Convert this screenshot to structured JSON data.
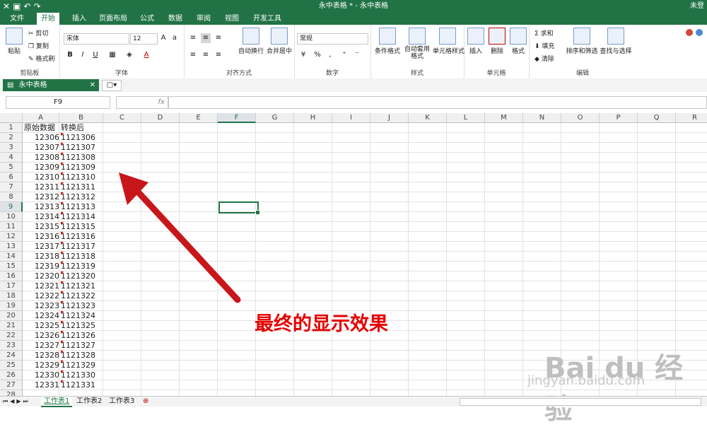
{
  "titlebar": {
    "title": "永中表格 * - 永中表格",
    "user": "未登",
    "undo_icon": "↶",
    "redo_icon": "↷"
  },
  "menu": [
    {
      "label": "文件"
    },
    {
      "label": "开始"
    },
    {
      "label": "插入"
    },
    {
      "label": "页面布局"
    },
    {
      "label": "公式"
    },
    {
      "label": "数据"
    },
    {
      "label": "审阅"
    },
    {
      "label": "视图"
    },
    {
      "label": "开发工具"
    }
  ],
  "ribbon": {
    "clipboard": {
      "paste": "粘贴",
      "cut": "剪切",
      "copy": "复制",
      "format_painter": "格式刷",
      "group": "剪贴板"
    },
    "font": {
      "name": "宋体",
      "size": "12",
      "bold": "B",
      "italic": "I",
      "underline": "U",
      "group": "字体",
      "font_color": "A"
    },
    "align": {
      "wrap": "自动换行",
      "merge": "合并居中",
      "group": "对齐方式"
    },
    "number": {
      "format": "常规",
      "percent": "%",
      "comma": ",",
      "group": "数字"
    },
    "styles": {
      "cond": "条件格式",
      "table": "自动套用格式",
      "cell": "单元格样式",
      "group": "样式"
    },
    "cells": {
      "insert": "插入",
      "delete": "删除",
      "format": "格式",
      "group": "单元格"
    },
    "edit": {
      "sum": "求和",
      "fill": "填充",
      "clear": "清除",
      "sort": "排序和筛选",
      "find": "查找与选择",
      "group": "编辑"
    }
  },
  "doc_tab": "永中表格",
  "formula": {
    "namebox": "F9",
    "fx": "fx",
    "content": ""
  },
  "columns": [
    "A",
    "B",
    "C",
    "D",
    "E",
    "F",
    "G",
    "H",
    "I",
    "J",
    "K",
    "L",
    "M",
    "N",
    "O",
    "P",
    "Q",
    "R"
  ],
  "rows": [
    {
      "n": "1",
      "a": "原始数据",
      "b": "转换后"
    },
    {
      "n": "2",
      "a": "12306",
      "b": "1121306"
    },
    {
      "n": "3",
      "a": "12307",
      "b": "1121307"
    },
    {
      "n": "4",
      "a": "12308",
      "b": "1121308"
    },
    {
      "n": "5",
      "a": "12309",
      "b": "1121309"
    },
    {
      "n": "6",
      "a": "12310",
      "b": "1121310"
    },
    {
      "n": "7",
      "a": "12311",
      "b": "1121311"
    },
    {
      "n": "8",
      "a": "12312",
      "b": "1121312"
    },
    {
      "n": "9",
      "a": "12313",
      "b": "1121313"
    },
    {
      "n": "10",
      "a": "12314",
      "b": "1121314"
    },
    {
      "n": "11",
      "a": "12315",
      "b": "1121315"
    },
    {
      "n": "12",
      "a": "12316",
      "b": "1121316"
    },
    {
      "n": "13",
      "a": "12317",
      "b": "1121317"
    },
    {
      "n": "14",
      "a": "12318",
      "b": "1121318"
    },
    {
      "n": "15",
      "a": "12319",
      "b": "1121319"
    },
    {
      "n": "16",
      "a": "12320",
      "b": "1121320"
    },
    {
      "n": "17",
      "a": "12321",
      "b": "1121321"
    },
    {
      "n": "18",
      "a": "12322",
      "b": "1121322"
    },
    {
      "n": "19",
      "a": "12323",
      "b": "1121323"
    },
    {
      "n": "20",
      "a": "12324",
      "b": "1121324"
    },
    {
      "n": "21",
      "a": "12325",
      "b": "1121325"
    },
    {
      "n": "22",
      "a": "12326",
      "b": "1121326"
    },
    {
      "n": "23",
      "a": "12327",
      "b": "1121327"
    },
    {
      "n": "24",
      "a": "12328",
      "b": "1121328"
    },
    {
      "n": "25",
      "a": "12329",
      "b": "1121329"
    },
    {
      "n": "26",
      "a": "12330",
      "b": "1121330"
    },
    {
      "n": "27",
      "a": "12331",
      "b": "1121331"
    },
    {
      "n": "28",
      "a": "",
      "b": ""
    }
  ],
  "annotation": "最终的显示效果",
  "sheets": [
    "工作表1",
    "工作表2",
    "工作表3"
  ],
  "watermark": {
    "main": "Bai du 经验",
    "sub": "jingyan.baidu.com"
  },
  "colors": {
    "accent": "#217346",
    "annotation": "#e60000"
  }
}
